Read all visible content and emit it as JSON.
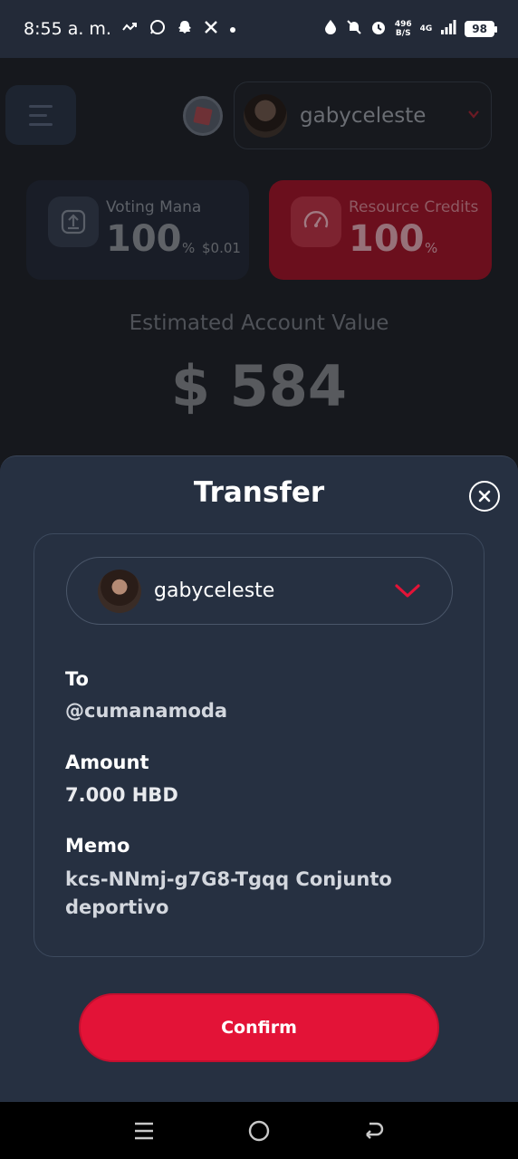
{
  "status_bar": {
    "time": "8:55 a. m.",
    "net_speed_value": "496",
    "net_speed_unit": "B/S",
    "network": "4G",
    "battery": "98"
  },
  "header": {
    "account_name": "gabyceleste"
  },
  "stats": {
    "voting": {
      "label": "Voting Mana",
      "value": "100",
      "unit": "%",
      "extra": "$0.01"
    },
    "resource": {
      "label": "Resource Credits",
      "value": "100",
      "unit": "%"
    }
  },
  "account_value": {
    "label": "Estimated Account Value",
    "value": "$ 584"
  },
  "transfer": {
    "title": "Transfer",
    "from_account": "gabyceleste",
    "to_label": "To",
    "to_value": "@cumanamoda",
    "amount_label": "Amount",
    "amount_value": "7.000 HBD",
    "memo_label": "Memo",
    "memo_value": "kcs-NNmj-g7G8-Tgqq Conjunto deportivo",
    "confirm_label": "Confirm"
  },
  "colors": {
    "accent": "#e31337",
    "sheet_bg": "#263041",
    "status_bg": "#232a38"
  }
}
